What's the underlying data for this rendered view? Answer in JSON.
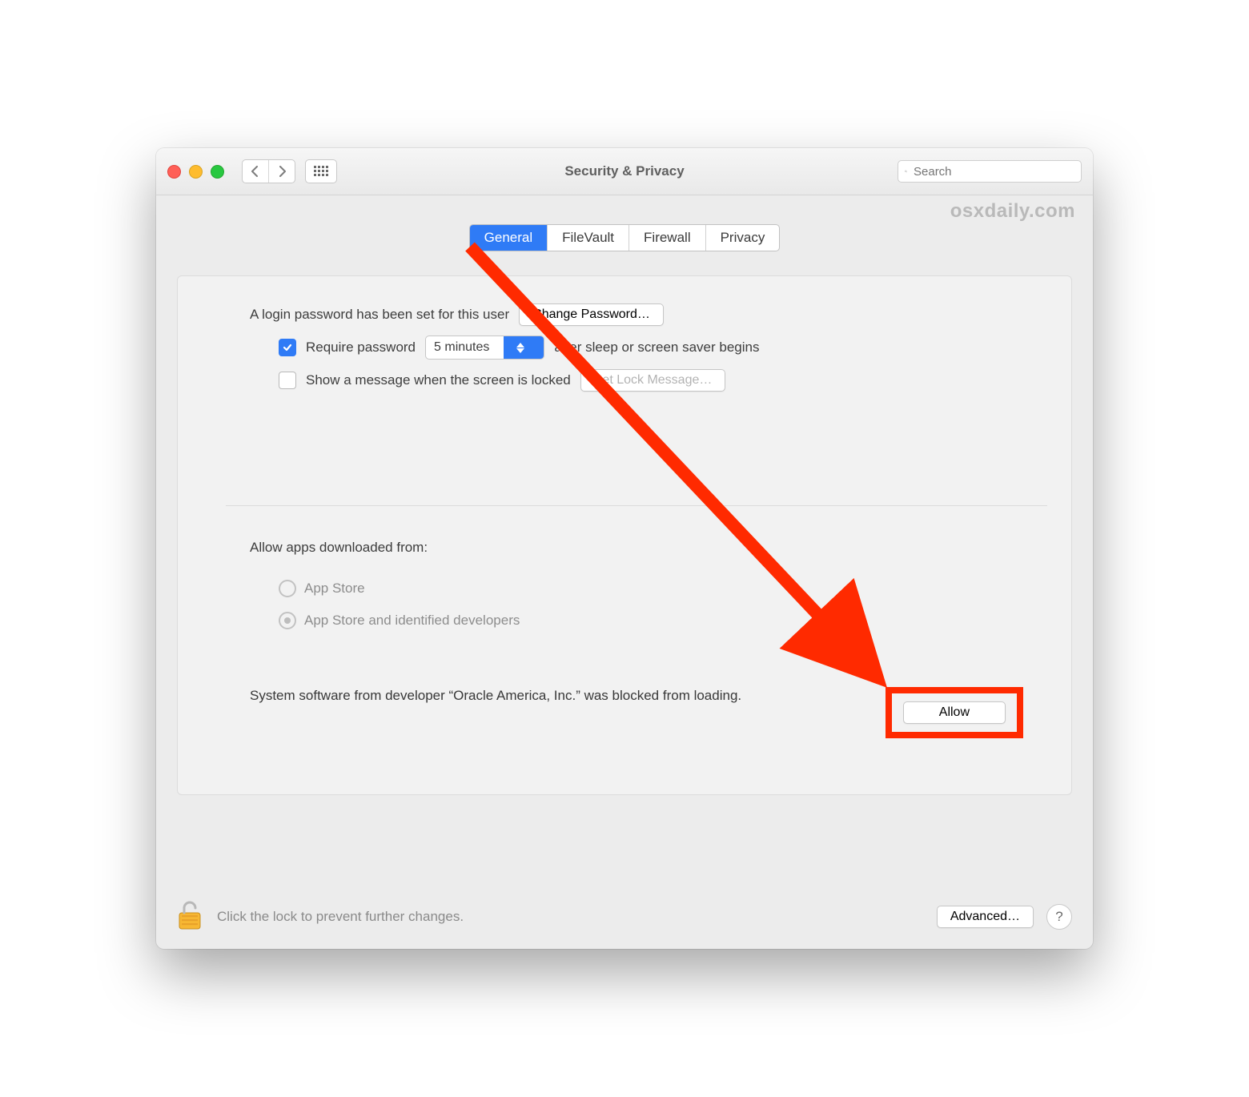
{
  "window": {
    "title": "Security & Privacy"
  },
  "watermark": "osxdaily.com",
  "search": {
    "placeholder": "Search"
  },
  "tabs": [
    "General",
    "FileVault",
    "Firewall",
    "Privacy"
  ],
  "active_tab_index": 0,
  "login": {
    "password_set_text": "A login password has been set for this user",
    "change_password_label": "Change Password…",
    "require_password_label": "Require password",
    "require_password_checked": true,
    "delay_value": "5 minutes",
    "after_sleep_text": "after sleep or screen saver begins",
    "show_message_label": "Show a message when the screen is locked",
    "show_message_checked": false,
    "set_lock_message_label": "Set Lock Message…"
  },
  "apps": {
    "section_label": "Allow apps downloaded from:",
    "options": [
      "App Store",
      "App Store and identified developers"
    ],
    "selected_index": 1
  },
  "blocked": {
    "text": "System software from developer “Oracle America, Inc.” was blocked from loading.",
    "allow_label": "Allow"
  },
  "footer": {
    "lock_note": "Click the lock to prevent further changes.",
    "advanced_label": "Advanced…"
  },
  "annotation": {
    "highlight_color": "#ff2a00"
  }
}
